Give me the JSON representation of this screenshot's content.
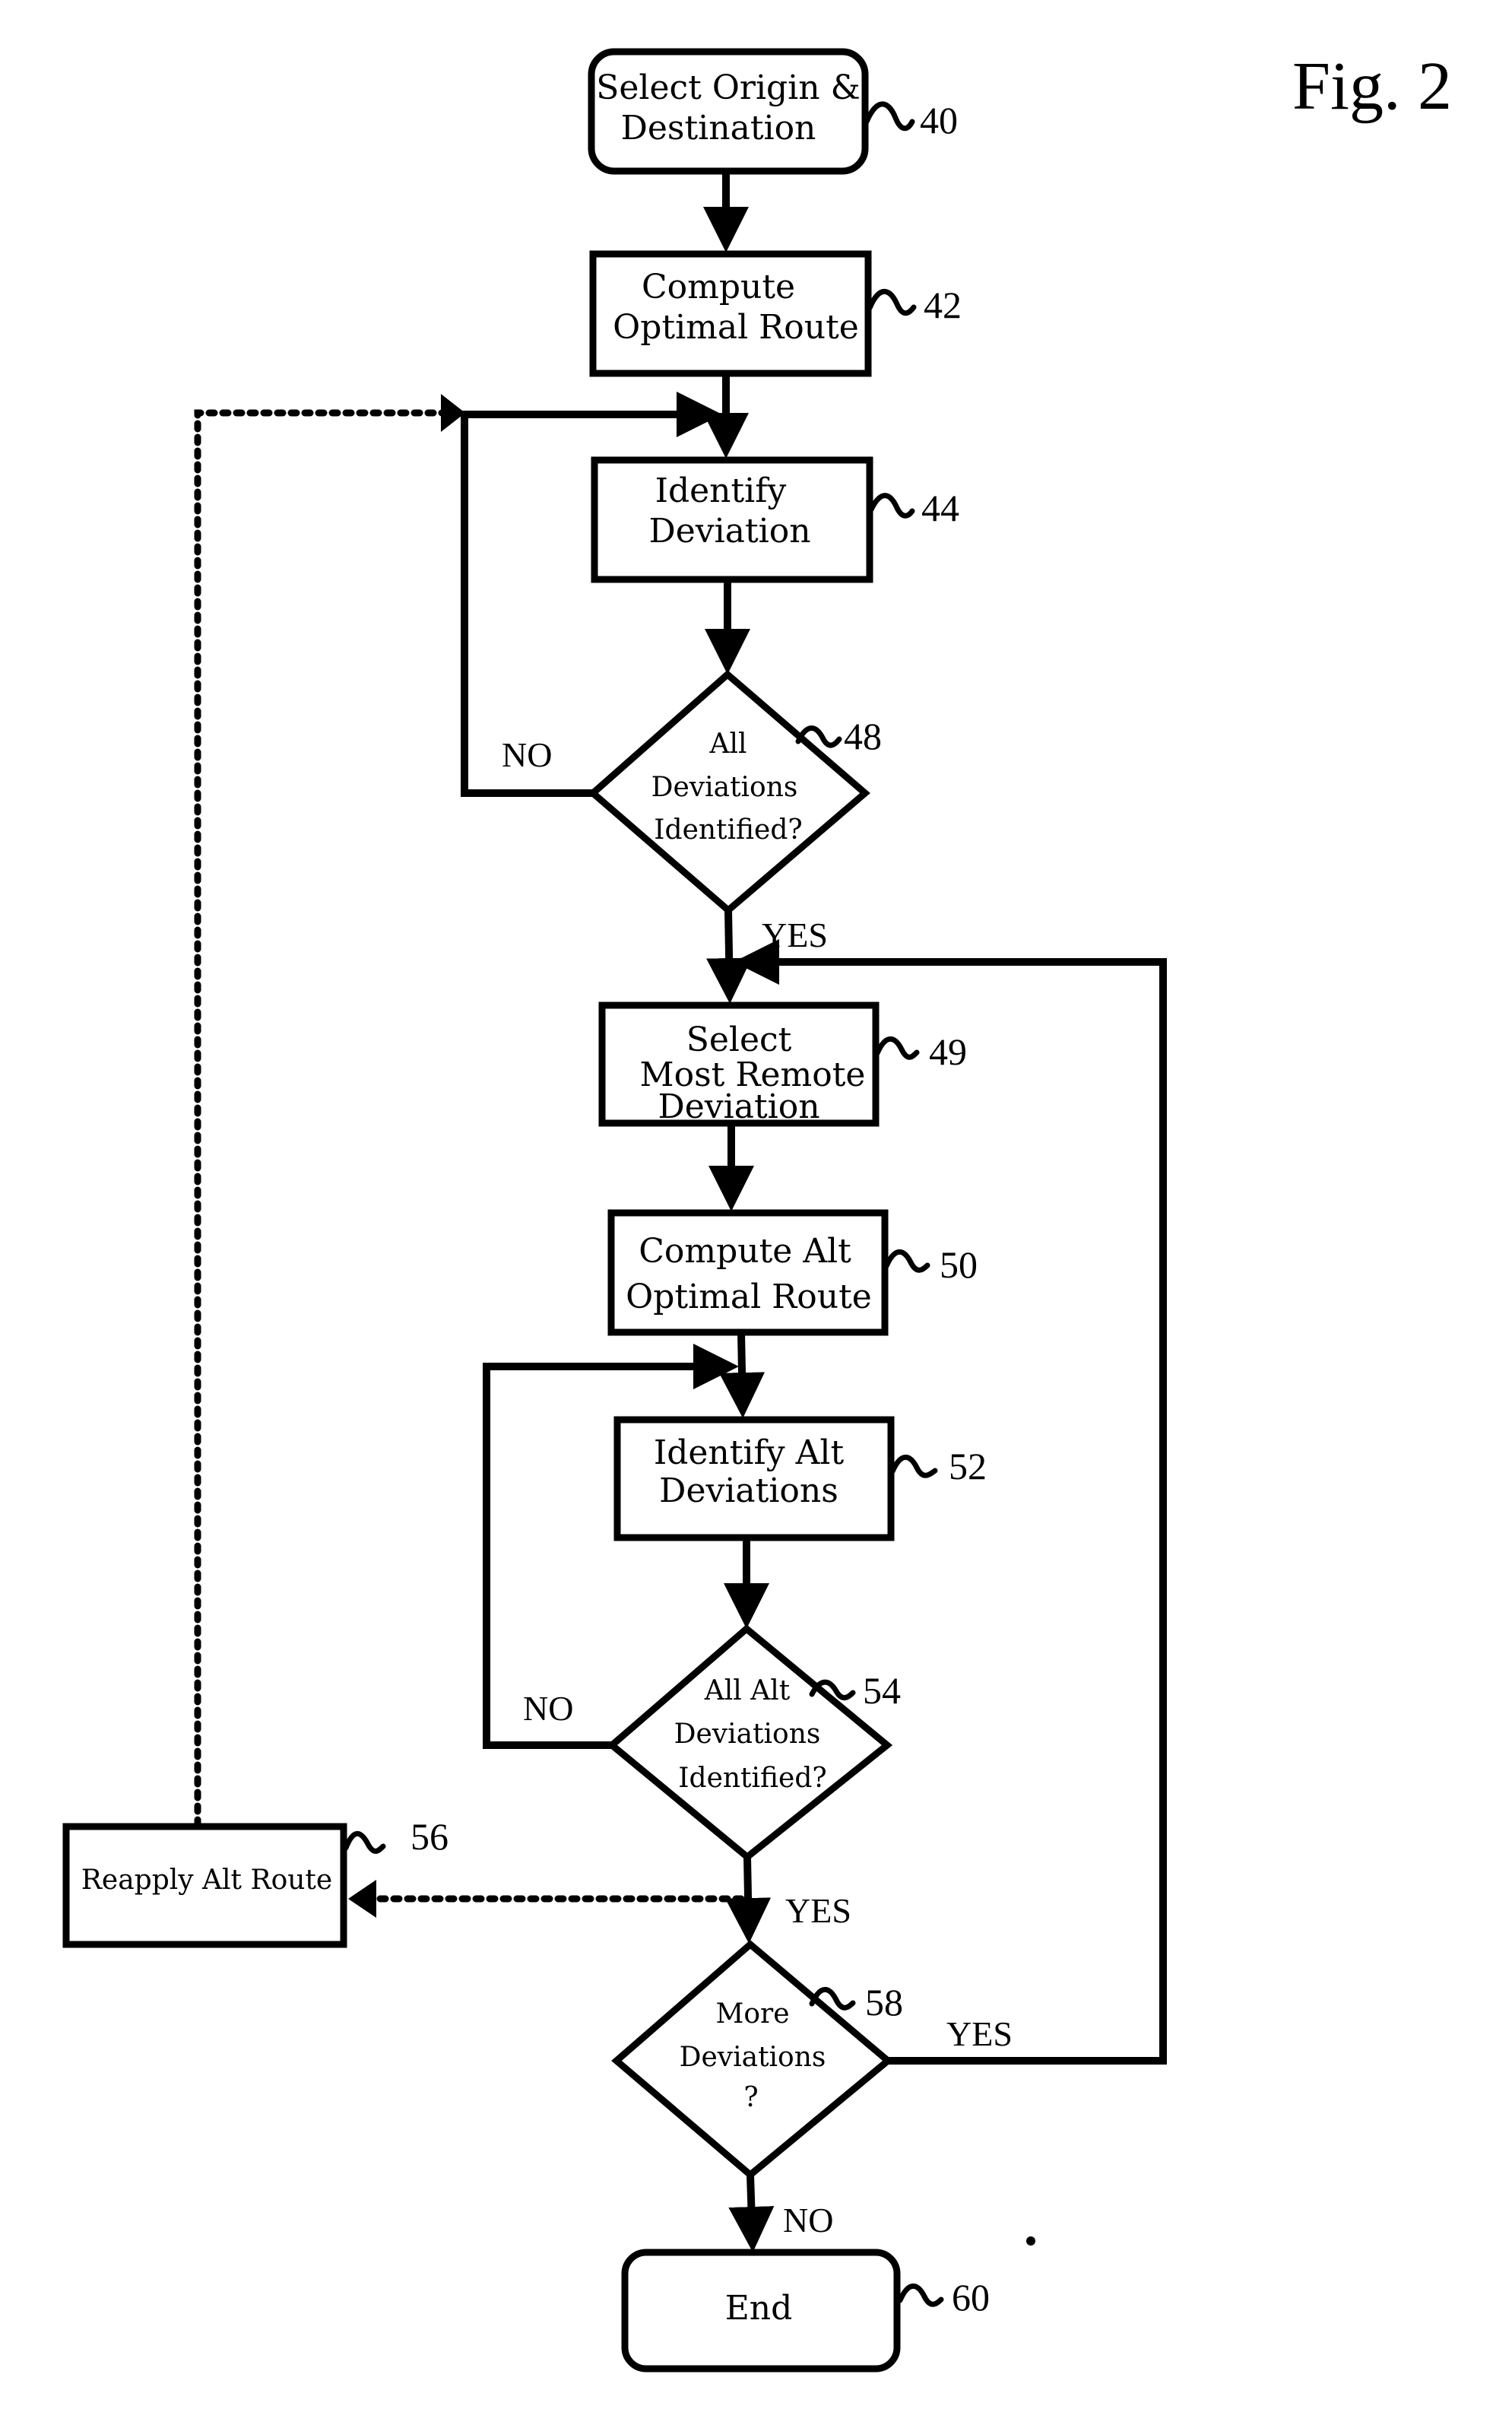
{
  "figure": {
    "title": "Fig. 2"
  },
  "nodes": {
    "n40": {
      "ref": "40",
      "shape": "rounded-rect",
      "lines": [
        "Select Origin &",
        "Destination"
      ]
    },
    "n42": {
      "ref": "42",
      "shape": "rect",
      "lines": [
        "Compute",
        "Optimal Route"
      ]
    },
    "n44": {
      "ref": "44",
      "shape": "rect",
      "lines": [
        "Identify",
        "Deviation"
      ]
    },
    "n48": {
      "ref": "48",
      "shape": "diamond",
      "lines": [
        "All",
        "Deviations",
        "Identified?"
      ]
    },
    "n49": {
      "ref": "49",
      "shape": "rect",
      "lines": [
        "Select",
        "Most Remote",
        "Deviation"
      ]
    },
    "n50": {
      "ref": "50",
      "shape": "rect",
      "lines": [
        "Compute Alt",
        "Optimal Route"
      ]
    },
    "n52": {
      "ref": "52",
      "shape": "rect",
      "lines": [
        "Identify Alt",
        "Deviations"
      ]
    },
    "n54": {
      "ref": "54",
      "shape": "diamond",
      "lines": [
        "All Alt",
        "Deviations",
        "Identified?"
      ]
    },
    "n56": {
      "ref": "56",
      "shape": "rect",
      "lines": [
        "Reapply Alt Route"
      ]
    },
    "n58": {
      "ref": "58",
      "shape": "diamond",
      "lines": [
        "More",
        "Deviations",
        "?"
      ]
    },
    "n60": {
      "ref": "60",
      "shape": "rounded-rect",
      "lines": [
        "End"
      ]
    }
  },
  "edges": [
    {
      "from": "40",
      "to": "42",
      "style": "solid",
      "label": ""
    },
    {
      "from": "42",
      "to": "44",
      "style": "solid",
      "label": ""
    },
    {
      "from": "44",
      "to": "48",
      "style": "solid",
      "label": ""
    },
    {
      "from": "48",
      "to": "44",
      "style": "solid",
      "label": "NO"
    },
    {
      "from": "48",
      "to": "49",
      "style": "solid",
      "label": "YES"
    },
    {
      "from": "49",
      "to": "50",
      "style": "solid",
      "label": ""
    },
    {
      "from": "50",
      "to": "52",
      "style": "solid",
      "label": ""
    },
    {
      "from": "52",
      "to": "54",
      "style": "solid",
      "label": ""
    },
    {
      "from": "54",
      "to": "52",
      "style": "solid",
      "label": "NO"
    },
    {
      "from": "54",
      "to": "58",
      "style": "solid",
      "label": "YES"
    },
    {
      "from": "54",
      "to": "56",
      "style": "dotted",
      "label": ""
    },
    {
      "from": "56",
      "to": "44",
      "style": "dotted",
      "label": ""
    },
    {
      "from": "58",
      "to": "49",
      "style": "solid",
      "label": "YES"
    },
    {
      "from": "58",
      "to": "60",
      "style": "solid",
      "label": "NO"
    }
  ],
  "labels": {
    "no_48": "NO",
    "yes_48": "YES",
    "no_54": "NO",
    "yes_54": "YES",
    "yes_58": "YES",
    "no_58": "NO"
  }
}
